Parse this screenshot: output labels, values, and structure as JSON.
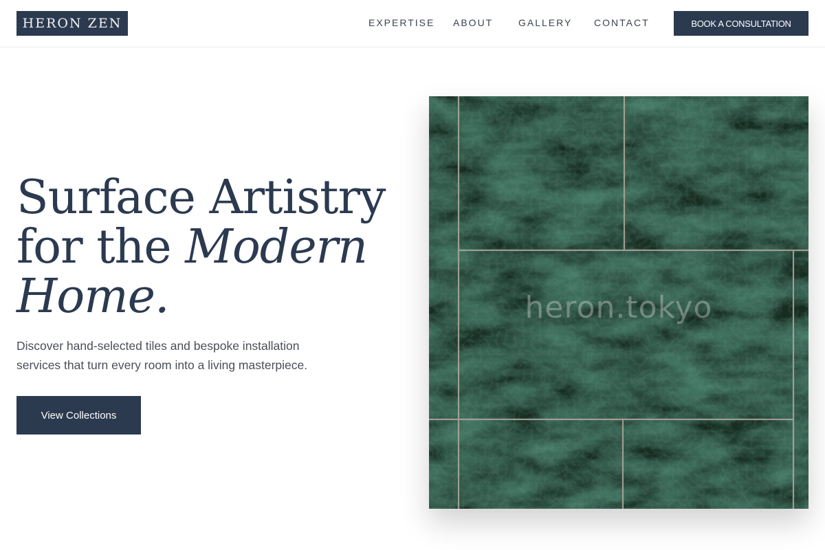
{
  "brand": {
    "logo_text": "HERON ZEN"
  },
  "nav": {
    "items": [
      "EXPERTISE",
      "ABOUT",
      "GALLERY",
      "CONTACT"
    ],
    "cta_label": "BOOK A CONSULTATION"
  },
  "hero": {
    "title_line1": "Surface Artistry",
    "title_line2_plain": "for the ",
    "title_line2_italic": "Modern",
    "title_line3_italic": "Home.",
    "subtitle": "Discover hand-selected tiles and bespoke installation services that turn every room into a living masterpiece.",
    "cta_label": "View Collections",
    "image_watermark": "heron.tokyo"
  },
  "colors": {
    "brand_navy": "#2c3a50",
    "nav_text": "#3b4350",
    "body_text": "#4a4f58",
    "marble_green": "#1f3d2c",
    "grout": "#d8cfc0"
  },
  "icons": {}
}
